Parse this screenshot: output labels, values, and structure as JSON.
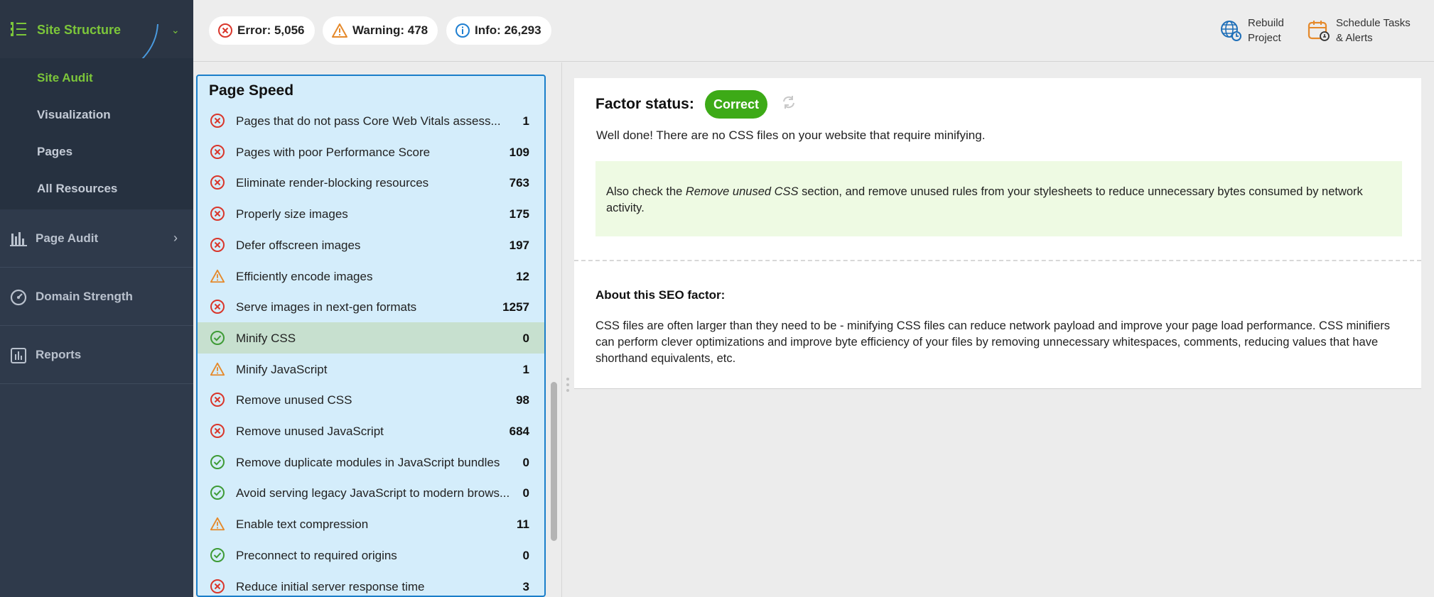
{
  "sidebar": {
    "header": {
      "label": "Site Structure",
      "icon": "site-structure-icon"
    },
    "subitems": [
      {
        "label": "Site Audit",
        "active": true
      },
      {
        "label": "Visualization",
        "active": false
      },
      {
        "label": "Pages",
        "active": false
      },
      {
        "label": "All Resources",
        "active": false
      }
    ],
    "groups": [
      {
        "label": "Page Audit",
        "icon": "page-audit-icon",
        "has_chevron": true
      },
      {
        "label": "Domain Strength",
        "icon": "gauge-icon",
        "has_chevron": false
      },
      {
        "label": "Reports",
        "icon": "reports-icon",
        "has_chevron": false
      }
    ]
  },
  "topbar": {
    "error": {
      "label": "Error:",
      "count": "5,056"
    },
    "warning": {
      "label": "Warning:",
      "count": "478"
    },
    "info": {
      "label": "Info:",
      "count": "26,293"
    },
    "rebuild": {
      "line1": "Rebuild",
      "line2": "Project"
    },
    "schedule": {
      "line1": "Schedule Tasks",
      "line2": "& Alerts"
    }
  },
  "list": {
    "title": "Page Speed",
    "rows": [
      {
        "status": "error",
        "label": "Pages that do not pass Core Web Vitals assess...",
        "count": "1"
      },
      {
        "status": "error",
        "label": "Pages with poor Performance Score",
        "count": "109"
      },
      {
        "status": "error",
        "label": "Eliminate render-blocking resources",
        "count": "763"
      },
      {
        "status": "error",
        "label": "Properly size images",
        "count": "175"
      },
      {
        "status": "error",
        "label": "Defer offscreen images",
        "count": "197"
      },
      {
        "status": "warning",
        "label": "Efficiently encode images",
        "count": "12"
      },
      {
        "status": "error",
        "label": "Serve images in next-gen formats",
        "count": "1257"
      },
      {
        "status": "ok",
        "label": "Minify CSS",
        "count": "0",
        "selected": true
      },
      {
        "status": "warning",
        "label": "Minify JavaScript",
        "count": "1"
      },
      {
        "status": "error",
        "label": "Remove unused CSS",
        "count": "98"
      },
      {
        "status": "error",
        "label": "Remove unused JavaScript",
        "count": "684"
      },
      {
        "status": "ok",
        "label": "Remove duplicate modules in JavaScript bundles",
        "count": "0"
      },
      {
        "status": "ok",
        "label": "Avoid serving legacy JavaScript to modern brows...",
        "count": "0"
      },
      {
        "status": "warning",
        "label": "Enable text compression",
        "count": "11"
      },
      {
        "status": "ok",
        "label": "Preconnect to required origins",
        "count": "0"
      },
      {
        "status": "error",
        "label": "Reduce initial server response time",
        "count": "3"
      }
    ]
  },
  "detail": {
    "factor_label": "Factor status:",
    "factor_value": "Correct",
    "message": "Well done! There are no CSS files on your website that require minifying.",
    "tip_prefix": "Also check the ",
    "tip_em": "Remove unused CSS",
    "tip_suffix": " section, and remove unused rules from your stylesheets to reduce unnecessary bytes consumed by network activity.",
    "about_title": "About this SEO factor:",
    "about_text": "CSS files are often larger than they need to be - minifying CSS files can reduce network payload and improve your page load performance. CSS minifiers can perform clever optimizations and improve byte efficiency of your files by removing unnecessary whitespaces, comments, reducing values that have shorthand equivalents, etc."
  },
  "colors": {
    "accent_green": "#7cc63a",
    "error_red": "#d9362b",
    "warning_orange": "#e5892a",
    "ok_green": "#3e9b36",
    "info_blue": "#1f7fd1"
  }
}
